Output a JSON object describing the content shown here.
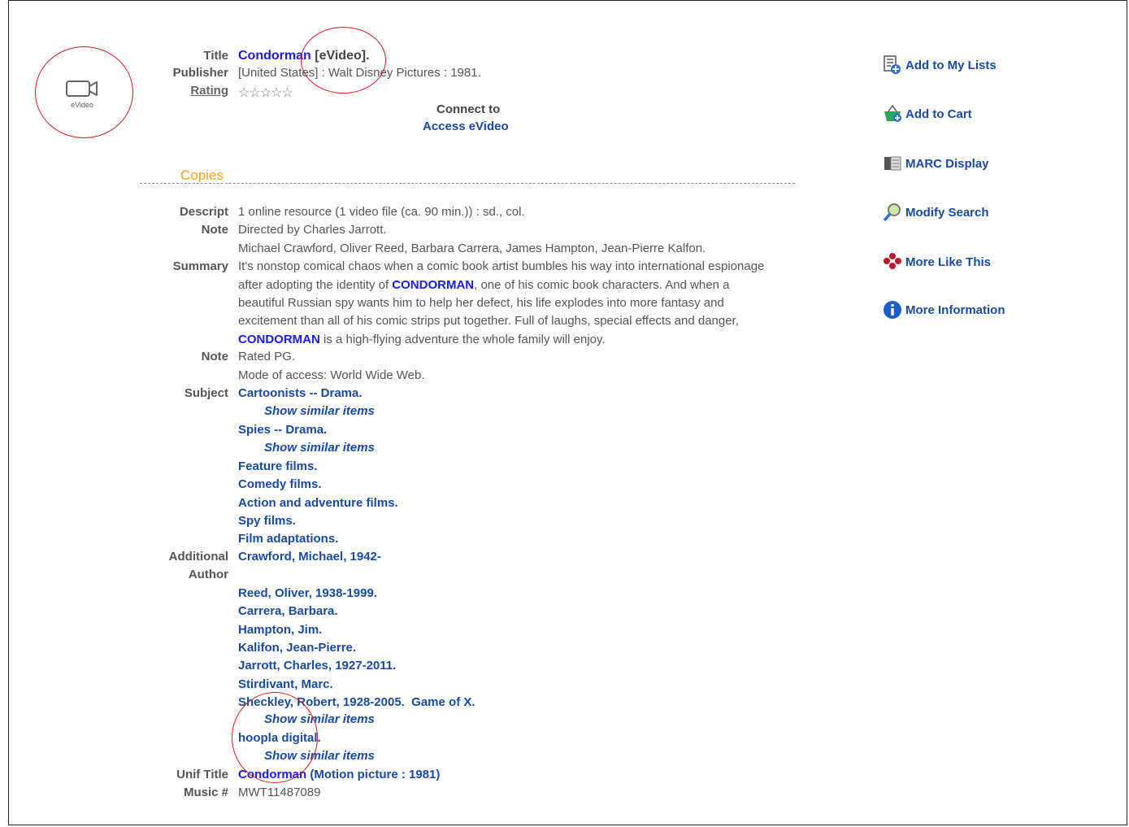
{
  "format_icon_label": "eVideo",
  "title": {
    "label": "Title",
    "name": "Condorman",
    "suffix": "[eVideo]."
  },
  "publisher": {
    "label": "Publisher",
    "value": "[United States] : Walt Disney Pictures : 1981."
  },
  "rating": {
    "label": "Rating",
    "stars": "☆☆☆☆☆"
  },
  "connect": {
    "heading": "Connect to",
    "link": "Access eVideo"
  },
  "copies_heading": "Copies",
  "descript": {
    "label": "Descript",
    "value": "1 online resource (1 video file (ca. 90 min.)) : sd., col."
  },
  "note1": {
    "label": "Note",
    "line1": "Directed by Charles Jarrott.",
    "line2": "Michael Crawford, Oliver Reed, Barbara Carrera, James Hampton, Jean-Pierre Kalfon."
  },
  "summary": {
    "label": "Summary",
    "l1": "It's nonstop comical chaos when a comic book artist bumbles his way into international espionage",
    "l2a": "after adopting the identity of ",
    "l2b": "CONDORMAN",
    "l2c": ", one of his comic book characters. And when a",
    "l3": "beautiful Russian spy wants him to help her defect, his life explodes into more fantasy and",
    "l4": "excitement than all of his comic strips put together. Full of laughs, special effects and danger,",
    "l5a": "CONDORMAN",
    "l5b": " is a high-flying adventure the whole family will enjoy."
  },
  "note2": {
    "label": "Note",
    "line1": "Rated PG.",
    "line2": "Mode of access: World Wide Web."
  },
  "subject": {
    "label": "Subject",
    "s1": "Cartoonists -- Drama.",
    "s2": "Spies -- Drama.",
    "s3": "Feature films.",
    "s4": "Comedy films.",
    "s5": "Action and adventure films.",
    "s6": "Spy films.",
    "s7": "Film adaptations."
  },
  "show_similar": "Show similar items",
  "additional_author": {
    "label1": "Additional",
    "label2": "Author",
    "a1": "Crawford, Michael, 1942-",
    "a2": "Reed, Oliver, 1938-1999.",
    "a3": "Carrera, Barbara.",
    "a4": "Hampton, Jim.",
    "a5": "Kalifon, Jean-Pierre.",
    "a6": "Jarrott, Charles, 1927-2011.",
    "a7": "Stirdivant, Marc.",
    "a8": "Sheckley, Robert, 1928-2005.  Game of X.",
    "a9": "hoopla digital."
  },
  "unif_title": {
    "label": "Unif Title",
    "link_a": "Condorman",
    "link_b": " (Motion picture : 1981)"
  },
  "music": {
    "label": "Music #",
    "value": "MWT11487089"
  },
  "actions": {
    "add_lists": "Add to My Lists",
    "add_cart": "Add to Cart",
    "marc": "MARC Display",
    "modify": "Modify Search",
    "more_like": "More Like This",
    "more_info": "More Information"
  },
  "colors": {
    "link": "#1a4aa0",
    "copies": "#f5a020",
    "annotation": "#d21f1f"
  }
}
